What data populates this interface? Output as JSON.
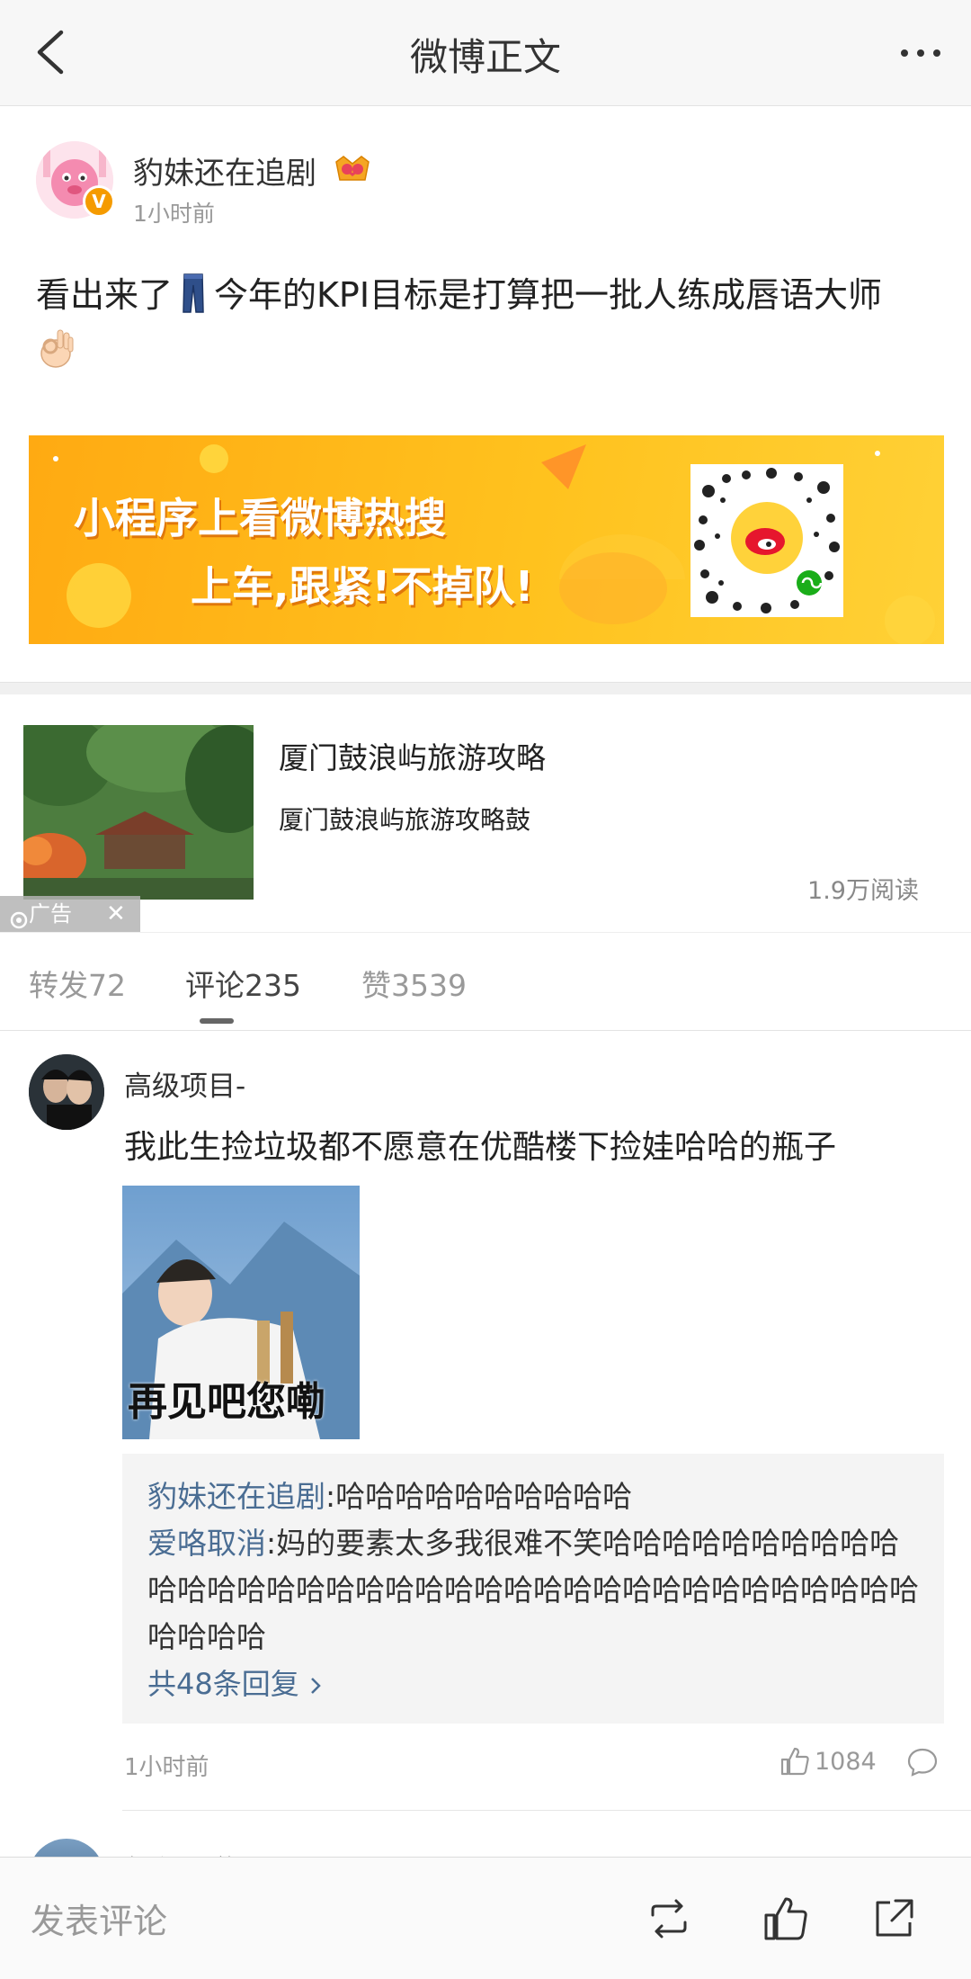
{
  "header": {
    "title": "微博正文"
  },
  "post": {
    "author": "豹妹还在追剧",
    "time": "1小时前",
    "text_before": "看出来了",
    "text_after": "今年的KPI目标是打算把一批人练成唇语大师"
  },
  "banner": {
    "line1": "小程序上看微博热搜",
    "line2": "上车,跟紧!不掉队!"
  },
  "ad": {
    "title": "厦门鼓浪屿旅游攻略",
    "description": "厦门鼓浪屿旅游攻略鼓",
    "reads": "1.9万阅读",
    "tag": "广告",
    "close": "✕"
  },
  "tabs": [
    {
      "label": "转发72"
    },
    {
      "label": "评论235"
    },
    {
      "label": "赞3539"
    }
  ],
  "comment": {
    "user": "高级项目-",
    "text": "我此生捡垃圾都不愿意在优酷楼下捡娃哈哈的瓶子",
    "image_caption": "再见吧您嘞",
    "replies": [
      {
        "user": "豹妹还在追剧",
        "text": ":哈哈哈哈哈哈哈哈哈哈"
      },
      {
        "user": "爱咯取消",
        "text": ":妈的要素太多我很难不笑哈哈哈哈哈哈哈哈哈哈哈哈哈哈哈哈哈哈哈哈哈哈哈哈哈哈哈哈哈哈哈哈哈哈哈哈哈哈哈哈"
      }
    ],
    "more_replies": "共48条回复",
    "time": "1小时前",
    "likes": "1084"
  },
  "next_comment": {
    "user": "何必用道"
  },
  "bottombar": {
    "input_placeholder": "发表评论"
  },
  "colors": {
    "link": "#4a6d93",
    "banner": "#ffaa12"
  },
  "icons": [
    "back-icon",
    "more-icon",
    "crown-icon",
    "verified-icon",
    "like-icon",
    "reply-icon",
    "repost-icon",
    "share-icon"
  ]
}
